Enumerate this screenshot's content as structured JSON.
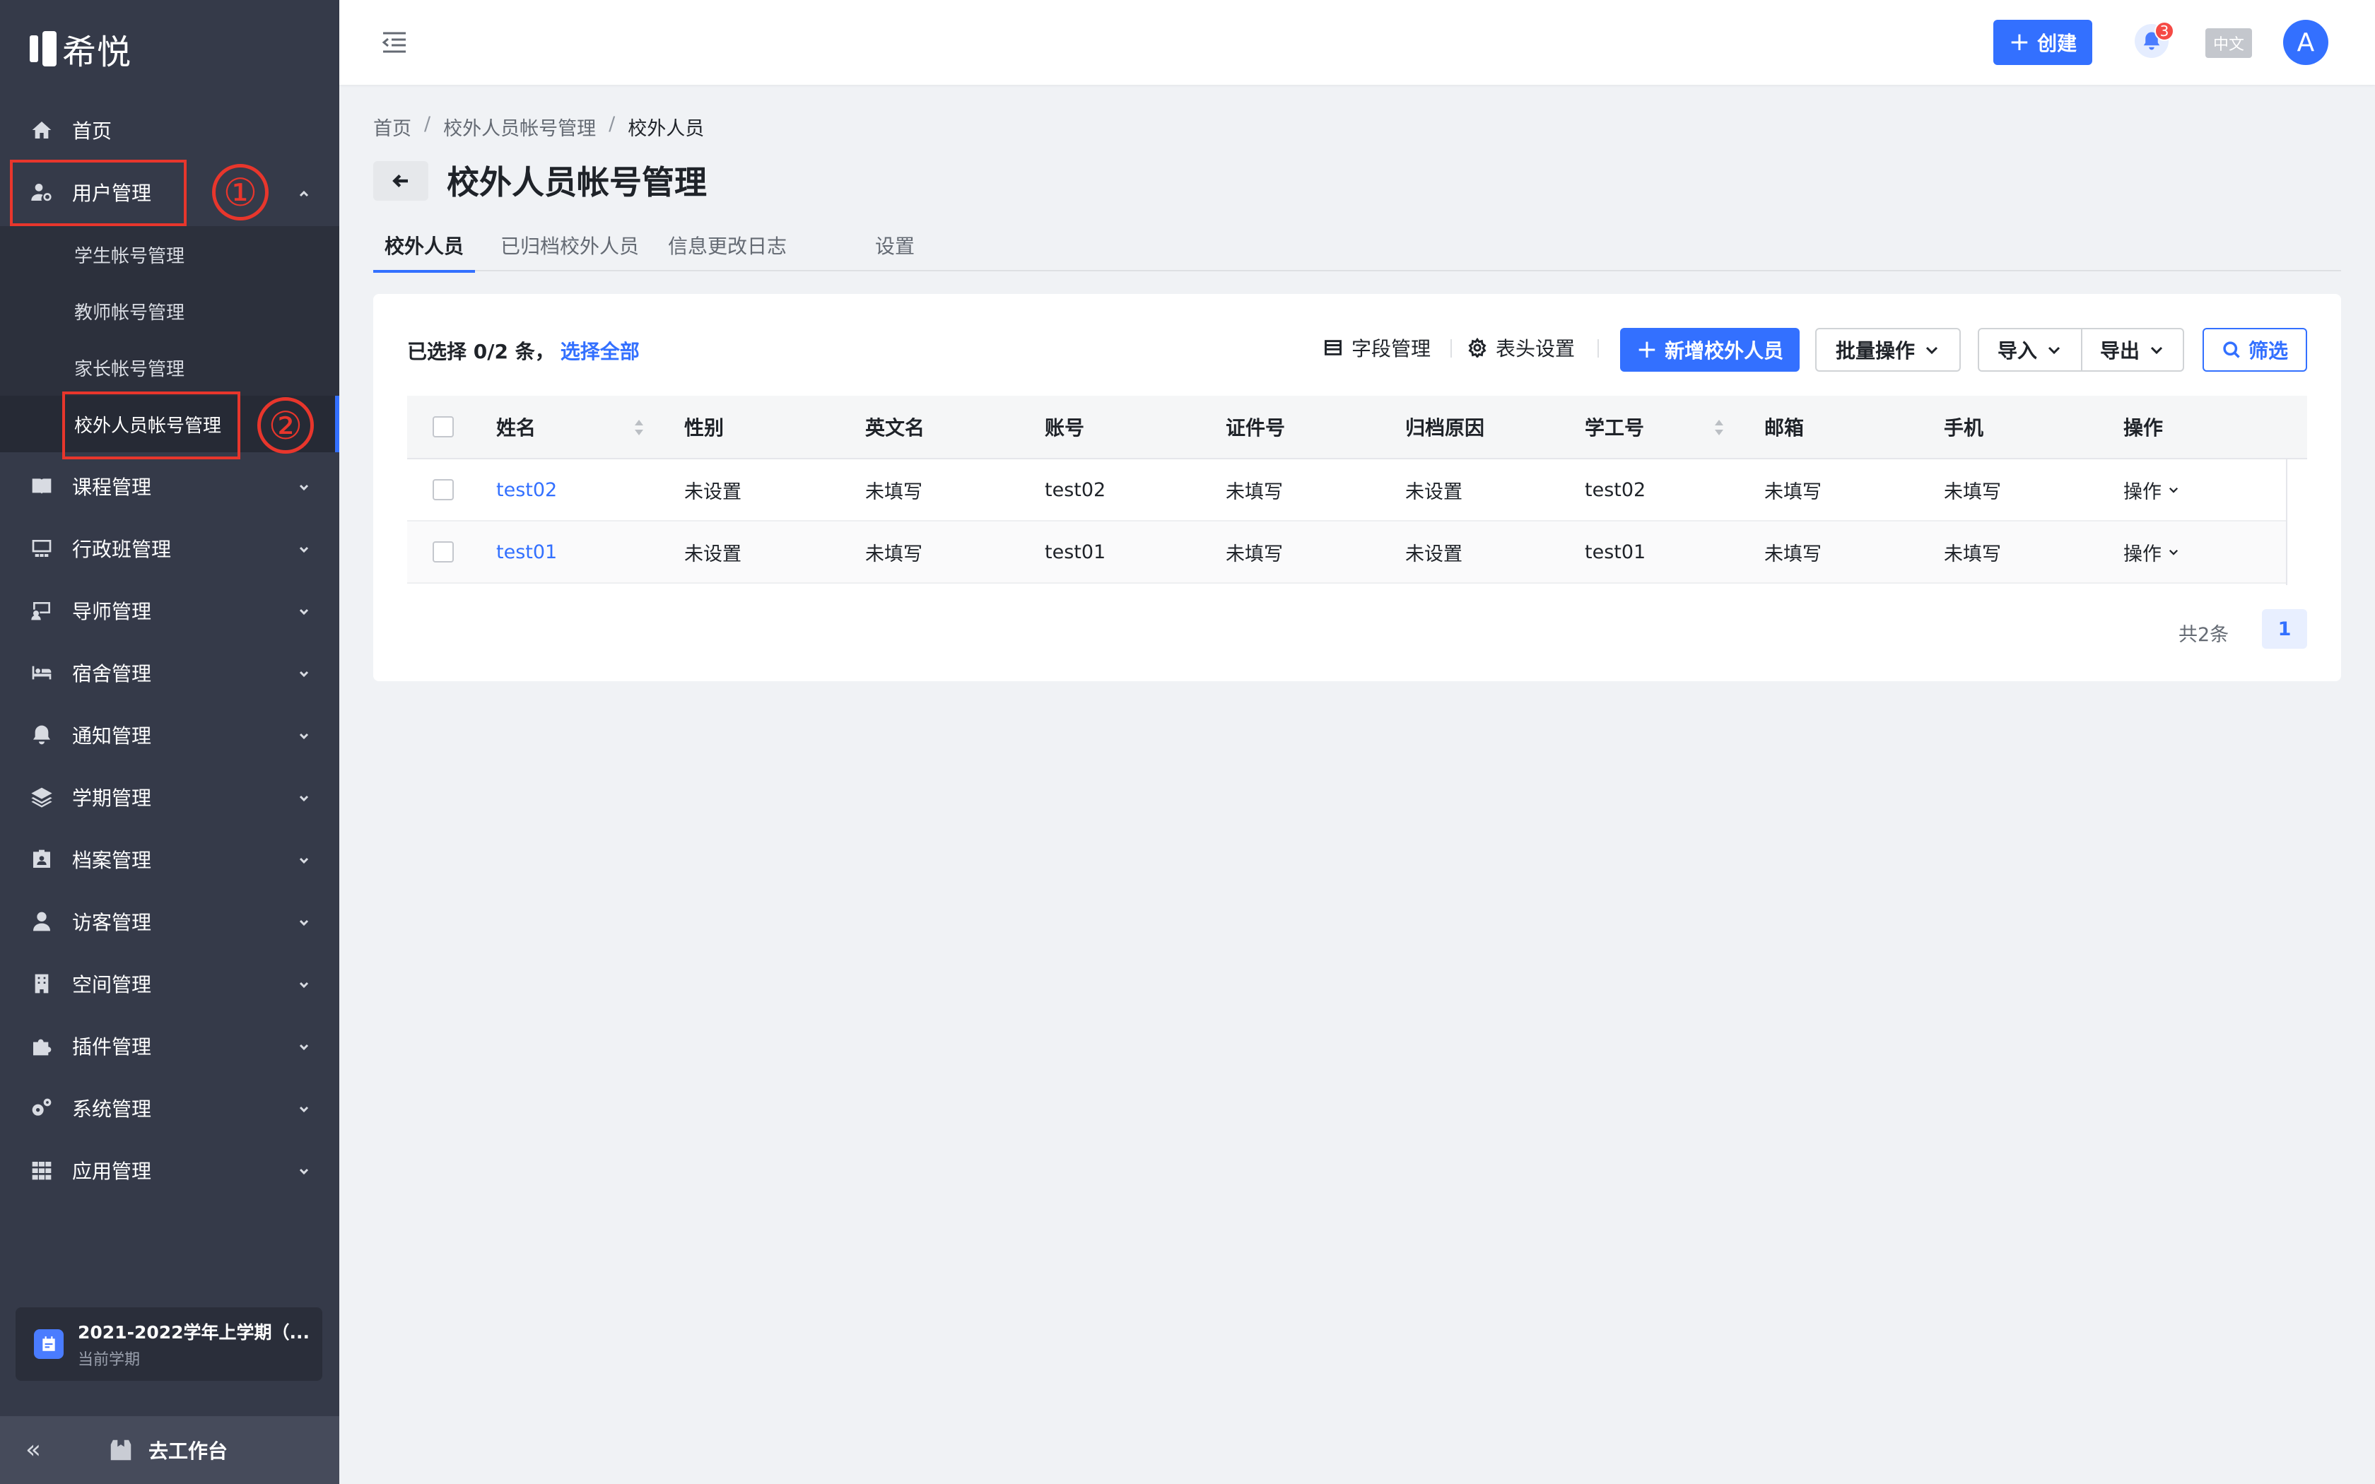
{
  "app": {
    "brand": "希悦"
  },
  "sidebar": {
    "items": [
      {
        "label": "首页",
        "icon": "home-icon"
      },
      {
        "label": "用户管理",
        "icon": "user-gear-icon",
        "expanded": true
      },
      {
        "label": "课程管理",
        "icon": "book-icon"
      },
      {
        "label": "行政班管理",
        "icon": "class-icon"
      },
      {
        "label": "导师管理",
        "icon": "mentor-icon"
      },
      {
        "label": "宿舍管理",
        "icon": "bed-icon"
      },
      {
        "label": "通知管理",
        "icon": "bell-icon"
      },
      {
        "label": "学期管理",
        "icon": "layers-icon"
      },
      {
        "label": "档案管理",
        "icon": "id-card-icon"
      },
      {
        "label": "访客管理",
        "icon": "visitor-icon"
      },
      {
        "label": "空间管理",
        "icon": "building-icon"
      },
      {
        "label": "插件管理",
        "icon": "puzzle-icon"
      },
      {
        "label": "系统管理",
        "icon": "gears-icon"
      },
      {
        "label": "应用管理",
        "icon": "grid-icon"
      }
    ],
    "submenu": [
      {
        "label": "学生帐号管理"
      },
      {
        "label": "教师帐号管理"
      },
      {
        "label": "家长帐号管理"
      },
      {
        "label": "校外人员帐号管理",
        "active": true
      }
    ],
    "annotations": [
      "①",
      "②"
    ],
    "term": {
      "title": "2021-2022学年上学期（...",
      "subtitle": "当前学期"
    },
    "footer": {
      "collapse": "«",
      "workbench": "去工作台"
    }
  },
  "header": {
    "create_label": "创建",
    "notification_count": "3",
    "language": "中文",
    "avatar_letter": "A"
  },
  "breadcrumb": [
    "首页",
    "校外人员帐号管理",
    "校外人员"
  ],
  "page": {
    "title": "校外人员帐号管理"
  },
  "tabs": [
    {
      "label": "校外人员",
      "active": true
    },
    {
      "label": "已归档校外人员"
    },
    {
      "label": "信息更改日志"
    },
    {
      "label": "设置"
    }
  ],
  "toolbar": {
    "selection_text": "已选择 0/2 条，",
    "select_all": "选择全部",
    "field_manage": "字段管理",
    "header_settings": "表头设置",
    "add_label": "新增校外人员",
    "batch_label": "批量操作",
    "import_label": "导入",
    "export_label": "导出",
    "filter_label": "筛选"
  },
  "table": {
    "columns": [
      "姓名",
      "性别",
      "英文名",
      "账号",
      "证件号",
      "归档原因",
      "学工号",
      "邮箱",
      "手机",
      "操作"
    ],
    "rows": [
      [
        "test02",
        "未设置",
        "未填写",
        "test02",
        "未填写",
        "未设置",
        "test02",
        "未填写",
        "未填写",
        "操作"
      ],
      [
        "test01",
        "未设置",
        "未填写",
        "test01",
        "未填写",
        "未设置",
        "test01",
        "未填写",
        "未填写",
        "操作"
      ]
    ]
  },
  "pagination": {
    "total": "共2条",
    "current_page": "1"
  },
  "colors": {
    "sidebar_bg": "#353a49",
    "accent": "#3370ff",
    "annotation_red": "#e8362c"
  }
}
